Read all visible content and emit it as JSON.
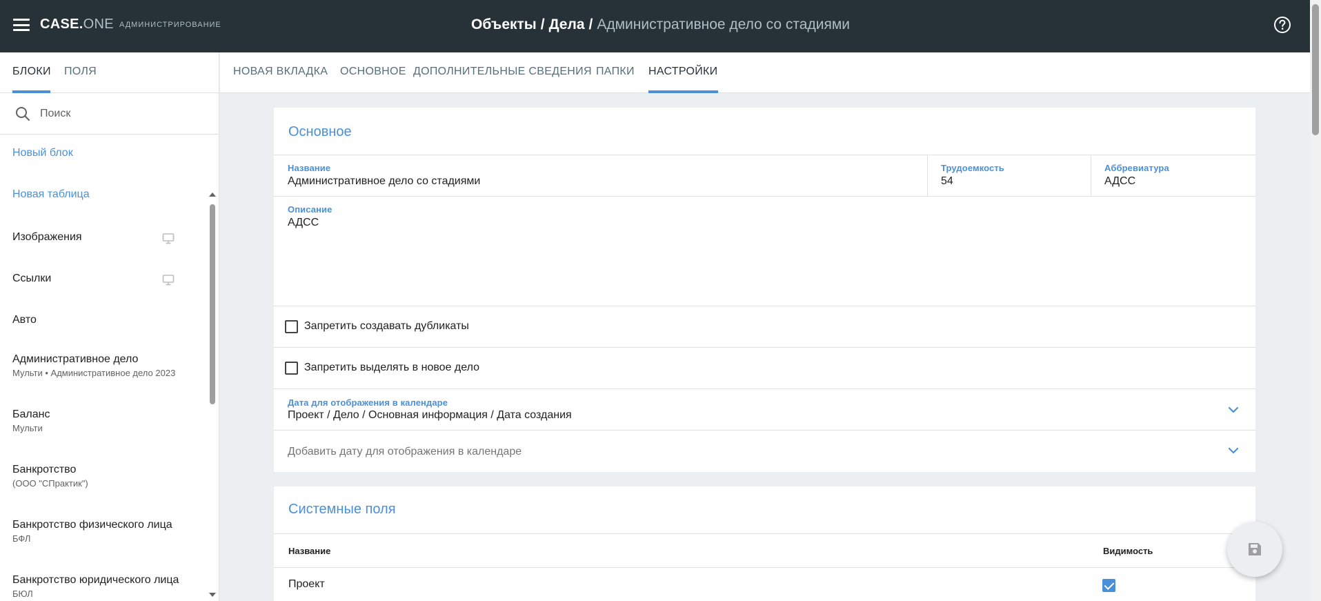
{
  "header": {
    "logo_main": "CASE.",
    "logo_sub": "ONE",
    "admin_label": "АДМИНИСТРИРОВАНИЕ",
    "breadcrumb": [
      "Объекты",
      "Дела"
    ],
    "separator": "/",
    "current": "Административное дело со стадиями",
    "hamburger_icon": "hamburger-icon",
    "help_icon": "help-circle-icon"
  },
  "left_panel": {
    "tabs": [
      "БЛОКИ",
      "ПОЛЯ"
    ],
    "active_tab": "БЛОКИ",
    "search_placeholder": "Поиск",
    "items": [
      {
        "title": "Новый блок",
        "subtitle": "",
        "link": true
      },
      {
        "title": "Новая таблица",
        "subtitle": "",
        "link": true
      },
      {
        "title": "Изображения",
        "subtitle": "",
        "icon": "monitor-icon"
      },
      {
        "title": "Ссылки",
        "subtitle": "",
        "icon": "monitor-icon"
      },
      {
        "title": "Авто",
        "subtitle": ""
      },
      {
        "title": "Административное дело",
        "subtitle": "Мульти • Административное дело 2023"
      },
      {
        "title": "Баланс",
        "subtitle": "Мульти"
      },
      {
        "title": "Банкротство",
        "subtitle": "(ООО \"СПрактик\")"
      },
      {
        "title": "Банкротство физического лица",
        "subtitle": "БФЛ"
      },
      {
        "title": "Банкротство юридического лица",
        "subtitle": "БЮЛ"
      }
    ]
  },
  "main_tabs": {
    "tabs": [
      "НОВАЯ ВКЛАДКА",
      "ОСНОВНОЕ",
      "ДОПОЛНИТЕЛЬНЫЕ СВЕДЕНИЯ",
      "ПАПКИ",
      "НАСТРОЙКИ"
    ],
    "active": "НАСТРОЙКИ"
  },
  "basic_card": {
    "title": "Основное",
    "name_label": "Название",
    "name_value": "Административное дело со стадиями",
    "effort_label": "Трудоемкость",
    "effort_value": "54",
    "abbr_label": "Аббревиатура",
    "abbr_value": "АДСС",
    "desc_label": "Описание",
    "desc_value": "АДСС",
    "checkbox_duplicates": {
      "label": "Запретить создавать дубликаты",
      "checked": false
    },
    "checkbox_new_case": {
      "label": "Запретить выделять в новое дело",
      "checked": false
    },
    "calendar_label": "Дата для отображения в календаре",
    "calendar_value": "Проект / Дело / Основная информация / Дата создания",
    "add_calendar_placeholder": "Добавить дату для отображения в календаре"
  },
  "system_fields": {
    "title": "Системные поля",
    "col_name": "Название",
    "col_visibility": "Видимость",
    "rows": [
      {
        "name": "Проект",
        "visible": true
      }
    ]
  },
  "colors": {
    "header_bg": "#263238",
    "accent": "#4a90d9",
    "page_bg": "#eceff1"
  },
  "fab_icon": "save-icon"
}
